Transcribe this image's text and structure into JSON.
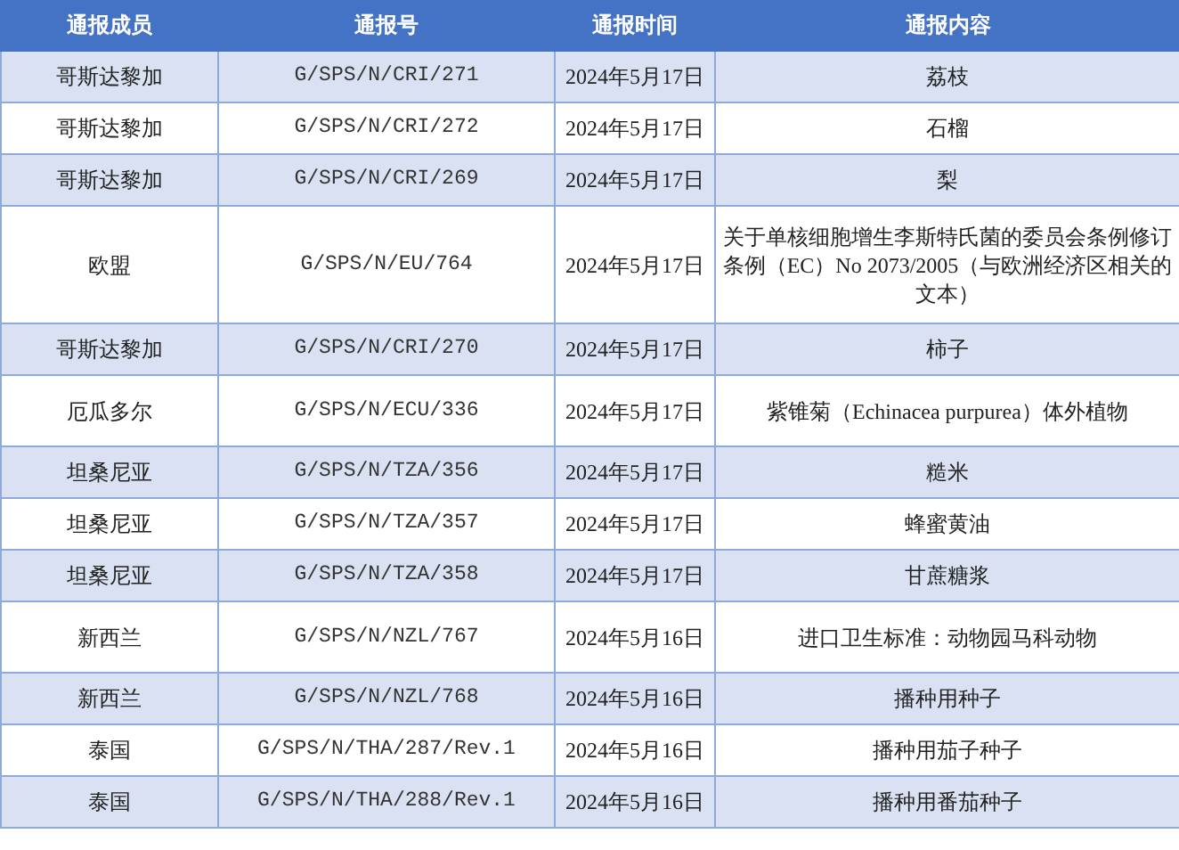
{
  "table": {
    "columns": [
      "通报成员",
      "通报号",
      "通报时间",
      "通报内容"
    ],
    "rows": [
      {
        "member": "哥斯达黎加",
        "number": "G/SPS/N/CRI/271",
        "date": "2024年5月17日",
        "content": "荔枝"
      },
      {
        "member": "哥斯达黎加",
        "number": "G/SPS/N/CRI/272",
        "date": "2024年5月17日",
        "content": "石榴"
      },
      {
        "member": "哥斯达黎加",
        "number": "G/SPS/N/CRI/269",
        "date": "2024年5月17日",
        "content": "梨"
      },
      {
        "member": "欧盟",
        "number": "G/SPS/N/EU/764",
        "date": "2024年5月17日",
        "content": "关于单核细胞增生李斯特氏菌的委员会条例修订条例（EC）No 2073/2005（与欧洲经济区相关的文本）"
      },
      {
        "member": "哥斯达黎加",
        "number": "G/SPS/N/CRI/270",
        "date": "2024年5月17日",
        "content": "柿子"
      },
      {
        "member": "厄瓜多尔",
        "number": "G/SPS/N/ECU/336",
        "date": "2024年5月17日",
        "content": "紫锥菊（Echinacea purpurea）体外植物"
      },
      {
        "member": "坦桑尼亚",
        "number": "G/SPS/N/TZA/356",
        "date": "2024年5月17日",
        "content": "糙米"
      },
      {
        "member": "坦桑尼亚",
        "number": "G/SPS/N/TZA/357",
        "date": "2024年5月17日",
        "content": "蜂蜜黄油"
      },
      {
        "member": "坦桑尼亚",
        "number": "G/SPS/N/TZA/358",
        "date": "2024年5月17日",
        "content": "甘蔗糖浆"
      },
      {
        "member": "新西兰",
        "number": "G/SPS/N/NZL/767",
        "date": "2024年5月16日",
        "content": "进口卫生标准：动物园马科动物"
      },
      {
        "member": "新西兰",
        "number": "G/SPS/N/NZL/768",
        "date": "2024年5月16日",
        "content": "播种用种子"
      },
      {
        "member": "泰国",
        "number": "G/SPS/N/THA/287/Rev.1",
        "date": "2024年5月16日",
        "content": "播种用茄子种子"
      },
      {
        "member": "泰国",
        "number": "G/SPS/N/THA/288/Rev.1",
        "date": "2024年5月16日",
        "content": "播种用番茄种子"
      }
    ]
  }
}
